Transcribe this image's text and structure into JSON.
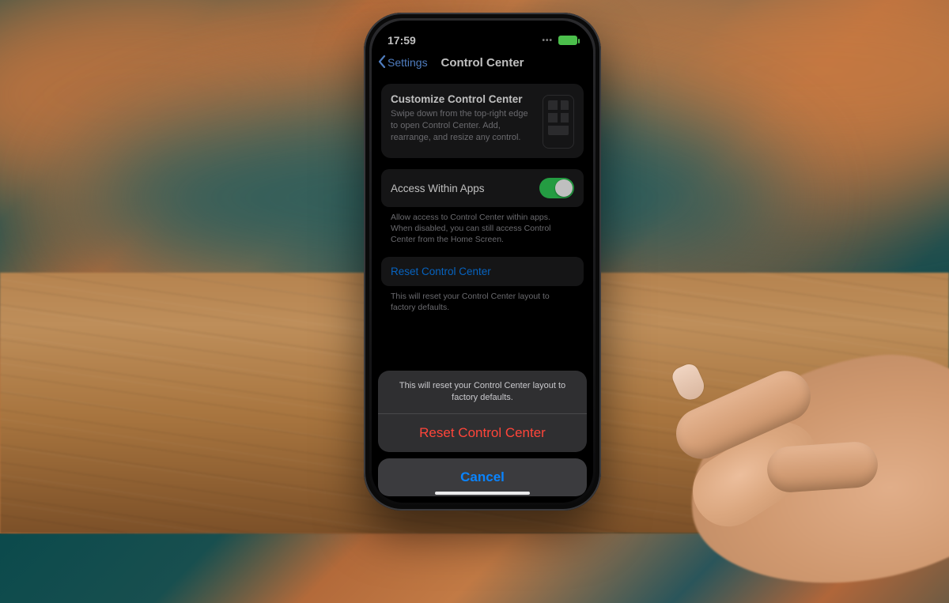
{
  "status": {
    "time": "17:59"
  },
  "nav": {
    "back_label": "Settings",
    "title": "Control Center"
  },
  "customize": {
    "title": "Customize Control Center",
    "desc": "Swipe down from the top-right edge to open Control Center. Add, rearrange, and resize any control."
  },
  "access": {
    "label": "Access Within Apps",
    "enabled": true,
    "note": "Allow access to Control Center within apps. When disabled, you can still access Control Center from the Home Screen."
  },
  "reset_row": {
    "label": "Reset Control Center",
    "note": "This will reset your Control Center layout to factory defaults."
  },
  "sheet": {
    "message": "This will reset your Control Center layout to factory defaults.",
    "destructive_label": "Reset Control Center",
    "cancel_label": "Cancel"
  }
}
